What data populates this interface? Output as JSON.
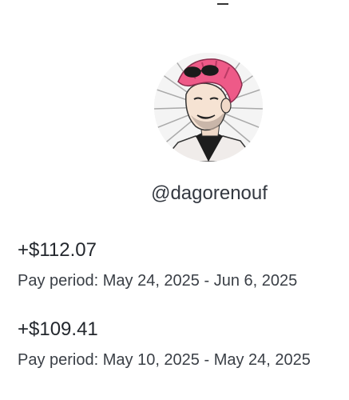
{
  "profile": {
    "username": "@dagorenouf"
  },
  "payments": [
    {
      "amount": "+$112.07",
      "period": "Pay period: May 24, 2025 - Jun 6, 2025"
    },
    {
      "amount": "+$109.41",
      "period": "Pay period: May 10, 2025 - May 24, 2025"
    }
  ],
  "colors": {
    "hair": "#ee5a88",
    "text": "#23272d"
  }
}
